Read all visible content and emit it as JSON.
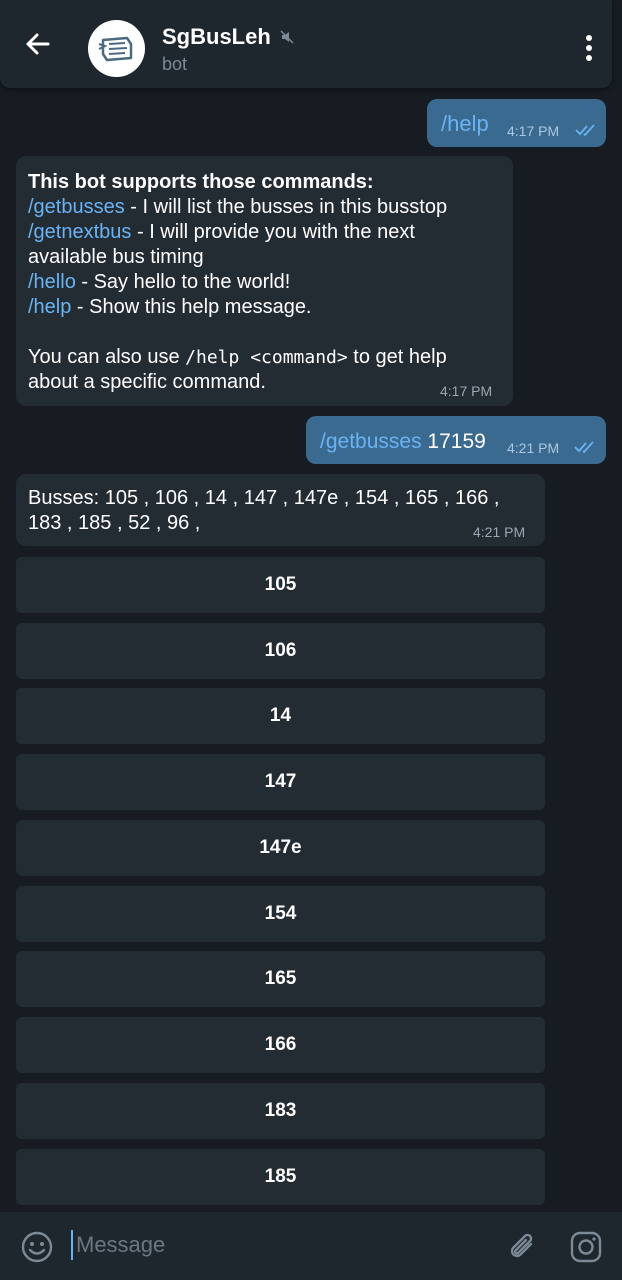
{
  "header": {
    "title": "SgBusLeh",
    "subtitle": "bot"
  },
  "messages": {
    "help_cmd": {
      "text": "/help",
      "time": "4:17 PM"
    },
    "help_reply": {
      "heading": "This bot supports those commands:",
      "lines": [
        {
          "cmd": "/getbusses",
          "desc": " - I will list the busses in this busstop"
        },
        {
          "cmd": "/getnextbus",
          "desc": " - I will provide you with the next"
        },
        {
          "cmd": "",
          "desc": "available bus timing"
        },
        {
          "cmd": "/hello",
          "desc": " - Say hello to the world!"
        },
        {
          "cmd": "/help",
          "desc": " - Show this help message."
        }
      ],
      "footer_pre": "You can also use ",
      "footer_code": "/help <command>",
      "footer_post": " to get help",
      "footer_line2": "about a specific command.",
      "time": "4:17 PM"
    },
    "getbusses_cmd": {
      "cmd": "/getbusses",
      "arg": " 17159",
      "time": "4:21 PM"
    },
    "busses_reply": {
      "line1": "Busses: 105 , 106 , 14 , 147 , 147e , 154 , 165 , 166 ,",
      "line2": "183 , 185 , 52 , 96 ,",
      "time": "4:21 PM"
    }
  },
  "keyboard": [
    "105",
    "106",
    "14",
    "147",
    "147e",
    "154",
    "165",
    "166",
    "183",
    "185"
  ],
  "input": {
    "placeholder": "Message"
  },
  "colors": {
    "accent": "#6ab3f3",
    "outgoing": "#3b6a91",
    "incoming": "#232b33",
    "background": "#161c22"
  },
  "icons": [
    "back-arrow-icon",
    "bot-avatar-icon",
    "mute-icon",
    "more-vert-icon",
    "double-check-icon",
    "emoji-icon",
    "attach-icon",
    "camera-icon"
  ]
}
